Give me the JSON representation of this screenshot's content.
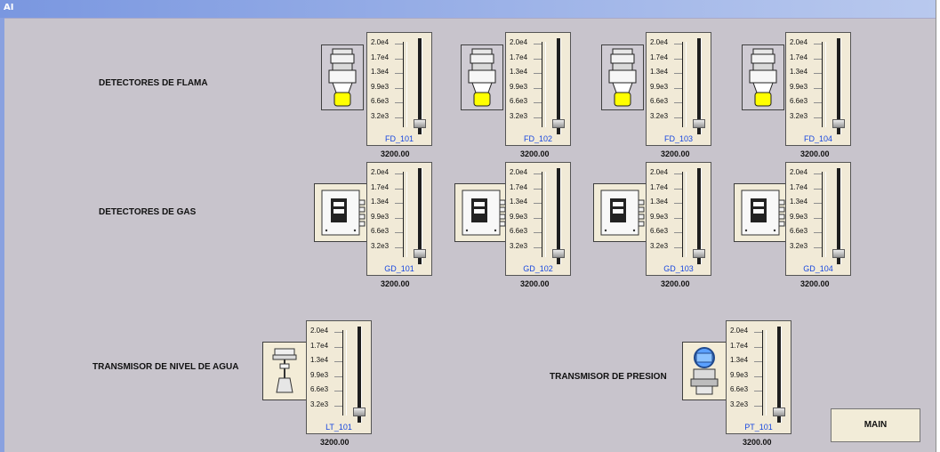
{
  "window": {
    "title": "AI"
  },
  "sections": {
    "flame": {
      "label": "DETECTORES DE FLAMA"
    },
    "gas": {
      "label": "DETECTORES DE GAS"
    },
    "water": {
      "label": "TRANSMISOR DE NIVEL DE AGUA"
    },
    "pressure": {
      "label": "TRANSMISOR DE PRESION"
    }
  },
  "tick_labels": [
    "2.0e4",
    "1.7e4",
    "1.3e4",
    "9.9e3",
    "6.6e3",
    "3.2e3"
  ],
  "meters": [
    {
      "id": "FD_101",
      "value": "3200.00"
    },
    {
      "id": "FD_102",
      "value": "3200.00"
    },
    {
      "id": "FD_103",
      "value": "3200.00"
    },
    {
      "id": "FD_104",
      "value": "3200.00"
    },
    {
      "id": "GD_101",
      "value": "3200.00"
    },
    {
      "id": "GD_102",
      "value": "3200.00"
    },
    {
      "id": "GD_103",
      "value": "3200.00"
    },
    {
      "id": "GD_104",
      "value": "3200.00"
    },
    {
      "id": "LT_101",
      "value": "3200.00"
    },
    {
      "id": "PT_101",
      "value": "3200.00"
    }
  ],
  "buttons": {
    "main": "MAIN"
  },
  "icons": {
    "flame_detector": "flame-detector-icon",
    "gas_detector": "gas-detector-icon",
    "level_transmitter": "radar-level-transmitter-icon",
    "pressure_transmitter": "pressure-transmitter-icon"
  },
  "colors": {
    "background": "#c8c4cc",
    "titlebar": "#7a97e0",
    "tag_text": "#1747e0",
    "meter_panel": "#f1ead7",
    "flame_yellow": "#ffff00"
  }
}
